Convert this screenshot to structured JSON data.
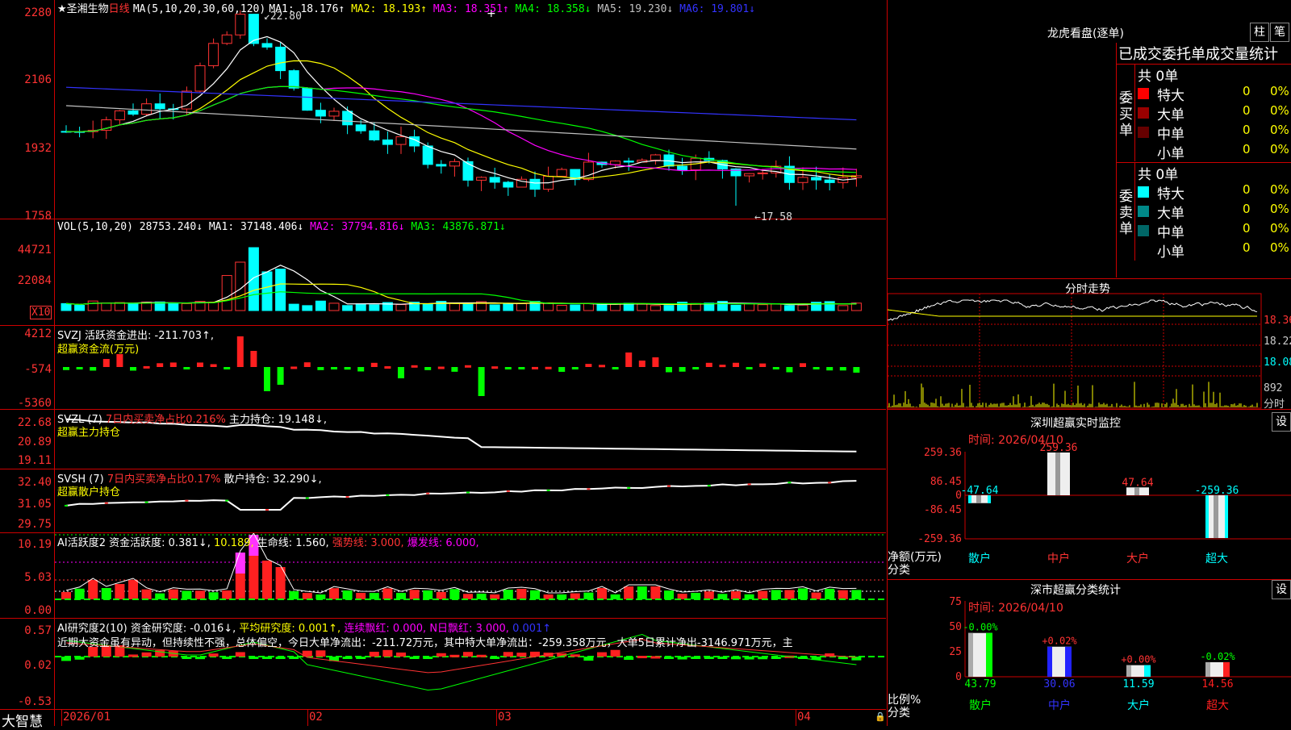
{
  "stock": {
    "name": "圣湘生物",
    "period": "日线"
  },
  "main_pane": {
    "ma_label": "MA(5,10,20,30,60,120)",
    "ma": [
      {
        "label": "MA1: 18.176↑",
        "color": "#ffffff"
      },
      {
        "label": "MA2: 18.193↑",
        "color": "#ffff00"
      },
      {
        "label": "MA3: 18.351↑",
        "color": "#ff00ff"
      },
      {
        "label": "MA4: 18.358↓",
        "color": "#00ff00"
      },
      {
        "label": "MA5: 19.230↓",
        "color": "#c0c0c0"
      },
      {
        "label": "MA6: 19.801↓",
        "color": "#3333ff"
      }
    ],
    "y_ticks": [
      "2280",
      "2106",
      "1932",
      "1758"
    ],
    "high_note": "22.80",
    "low_note": "←17.58"
  },
  "vol_pane": {
    "label": "VOL(5,10,20)",
    "value": "28753.240↓",
    "ma": [
      {
        "label": "MA1: 37148.406↓",
        "color": "#ffffff"
      },
      {
        "label": "MA2: 37794.816↓",
        "color": "#ff00ff"
      },
      {
        "label": "MA3: 43876.871↓",
        "color": "#00ff00"
      }
    ],
    "y_ticks": [
      "44721",
      "22084"
    ],
    "unit": "X10"
  },
  "svzj_pane": {
    "label": "SVZJ  活跃资金进出: -211.703↑,",
    "sub": "超赢资金流(万元)",
    "y_ticks": [
      "4212",
      "-574",
      "-5360"
    ]
  },
  "svzl_pane": {
    "label": "SVZL (7)",
    "text1": "7日内买卖净占比0.216%",
    "text2": "主力持仓: 19.148↓,",
    "sub": "超赢主力持仓",
    "y_ticks": [
      "22.68",
      "20.89",
      "19.11"
    ]
  },
  "svsh_pane": {
    "label": "SVSH (7)",
    "text1": "7日内买卖净占比0.17%",
    "text2": "散户持仓: 32.290↓,",
    "sub": "超赢散户持仓",
    "y_ticks": [
      "32.40",
      "31.05",
      "29.75"
    ]
  },
  "ai_pane": {
    "label": "AI活跃度2 资金活跃度: 0.381↓,",
    "v2": "10.189,",
    "v3": "生命线: 1.560,",
    "v4": "强势线: 3.000,",
    "v5": "爆发线: 6.000,",
    "y_ticks": [
      "10.19",
      "5.03",
      "0.00"
    ]
  },
  "research_pane": {
    "label": "AI研究度2(10) 资金研究度: -0.016↓,",
    "v2": "平均研究度: 0.001↑,",
    "v3": "连续飘红: 0.000,",
    "v4": "N日飘红: 3.000,",
    "v5": "0.001↑",
    "comment": "近期大资金虽有异动，但持续性不强，总体偏空，今日大单净流出：-211.72万元，其中特大单净流出：-259.358万元，大单5日累计净出-3146.971万元，主",
    "y_ticks": [
      "0.57",
      "0.02",
      "-0.53"
    ]
  },
  "x_axis": {
    "labels": [
      "2026/01",
      "02",
      "03",
      "04"
    ]
  },
  "footer": {
    "brand": "大智慧"
  },
  "dragon_tiger": {
    "title": "龙虎看盘(逐单)",
    "btn1": "柱",
    "btn2": "笔",
    "heading": "已成交委托单成交量统计",
    "buy": {
      "label": "委买单",
      "total": "共 0单",
      "rows": [
        {
          "name": "特大",
          "count": "0",
          "pct": "0%",
          "color": "#ff0000"
        },
        {
          "name": "大单",
          "count": "0",
          "pct": "0%",
          "color": "#990000"
        },
        {
          "name": "中单",
          "count": "0",
          "pct": "0%",
          "color": "#660000"
        },
        {
          "name": "小单",
          "count": "0",
          "pct": "0%",
          "color": "#000000"
        }
      ]
    },
    "sell": {
      "label": "委卖单",
      "total": "共 0单",
      "rows": [
        {
          "name": "特大",
          "count": "0",
          "pct": "0%",
          "color": "#00ffff"
        },
        {
          "name": "大单",
          "count": "0",
          "pct": "0%",
          "color": "#008888"
        },
        {
          "name": "中单",
          "count": "0",
          "pct": "0%",
          "color": "#006666"
        },
        {
          "name": "小单",
          "count": "0",
          "pct": "0%",
          "color": "#000000"
        }
      ]
    }
  },
  "intraday": {
    "title": "分时走势",
    "y_ticks": [
      "18.36",
      "18.22",
      "18.08"
    ],
    "vol_tick": "892",
    "vol_label": "分时"
  },
  "sz_monitor": {
    "title": "深圳超赢实时监控",
    "btn": "设",
    "time": "时间: 2026/04/10",
    "y_ticks": [
      "259.36",
      "86.45",
      "0",
      "-86.45",
      "-259.36"
    ],
    "ylabel": "净额(万元)",
    "xlabel": "分类",
    "categories": [
      "散户",
      "中户",
      "大户",
      "超大"
    ],
    "values": [
      -47.64,
      259.36,
      47.64,
      -259.36
    ],
    "value_labels": [
      "-47.64",
      "259.36",
      "47.64",
      "-259.36"
    ]
  },
  "sz_class": {
    "title": "深市超赢分类统计",
    "btn": "设",
    "time": "时间: 2026/04/10",
    "y_ticks": [
      "75",
      "50",
      "25",
      "0"
    ],
    "ylabel": "比例%",
    "xlabel": "分类",
    "categories": [
      "散户",
      "中户",
      "大户",
      "超大"
    ],
    "values": [
      43.79,
      30.06,
      11.59,
      14.56
    ],
    "value_labels": [
      "43.79",
      "30.06",
      "11.59",
      "14.56"
    ],
    "change_labels": [
      "-0.00%",
      "+0.02%",
      "+0.00%",
      "-0.02%"
    ]
  }
}
